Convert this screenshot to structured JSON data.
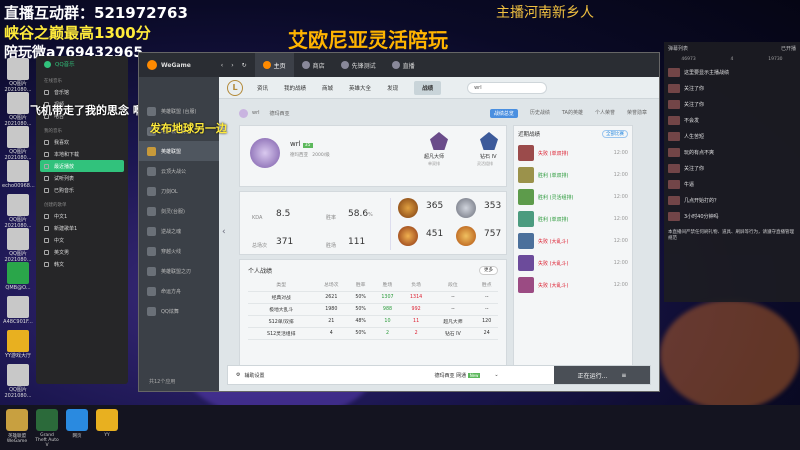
{
  "overlay": {
    "line1": "直播互动群：521972763",
    "line2": "峡谷之巅最高1300分",
    "line3": "陪玩微a769432965",
    "center_title": "艾欧尼亚灵活陪玩",
    "top_right": "主播河南新乡人",
    "tip1": "飞机带走了我的思念 啊",
    "tip2": "发布地球另一边"
  },
  "desktop": [
    "QQ图片 2021080...",
    "QQ图片 2021080...",
    "QQ图片 2021080...",
    "echo00968...",
    "QQ图片 2021080...",
    "QQ图片 2021080...",
    "QMB@O...",
    "A48C901F...",
    "YY游戏大厅",
    "QQ图片 2021080..."
  ],
  "qqmusic": {
    "title": "QQ音乐",
    "sec_online": "在线音乐",
    "online": [
      "音乐馆",
      "视频",
      "电台"
    ],
    "sec_mine": "我的音乐",
    "mine": [
      "我喜欢",
      "本地和下载",
      "最近播放",
      "试听列表",
      "已购音乐"
    ],
    "sec_created": "创建的歌单",
    "created": [
      "中文1",
      "新建歌单1",
      "中文",
      "英文男",
      "韩文"
    ]
  },
  "wegame": {
    "logo": "WeGame",
    "tabs": [
      "主页",
      "商店",
      "先锋测试",
      "直播"
    ],
    "side": [
      "英雄联盟 (台服)",
      "地下城与勇士",
      "英雄联盟",
      "云顶大战公",
      "刀剑OL",
      "剑灵(台服)",
      "逆战之魂",
      "穿越火线",
      "英雄联盟之刃",
      "命运方舟",
      "QQ炫舞"
    ],
    "side_bottom": "共12个应用",
    "bottom_left": "辅助设置",
    "bottom_server": "德玛西亚 网通",
    "bottom_tag": "New",
    "bottom_btn": "正在运行..."
  },
  "lol": {
    "nav": [
      "资讯",
      "我的战绩",
      "商城",
      "英雄大全",
      "发现",
      "战绩"
    ],
    "search": "wrl",
    "subtabs": [
      "战绩总览",
      "历史战绩",
      "TA的英雄",
      "个人荣誉",
      "荣誉勋章"
    ],
    "profile": {
      "name": "wrl",
      "badge": "35",
      "server": "德玛西亚",
      "level": "2000/级",
      "rank1": "超凡大师",
      "rank1sub": "单双排",
      "rank2": "钻石 IV",
      "rank2sub": "灵活组排"
    },
    "stats": [
      {
        "k": "KDA",
        "v": "8.5"
      },
      {
        "k": "胜率",
        "v": "58.6",
        "u": "%"
      },
      {
        "k": "总场次",
        "v": "371"
      },
      {
        "k": "胜场",
        "v": "111"
      }
    ],
    "badges": [
      "365",
      "353",
      "451",
      "757"
    ],
    "table_title": "个人战绩",
    "more": "更多",
    "headers": [
      "类型",
      "总场次",
      "胜率",
      "胜场",
      "负场",
      "段位",
      "胜点"
    ],
    "rows": [
      [
        "经典对战",
        "2621",
        "50%",
        "1307",
        "1314",
        "--",
        "--"
      ],
      [
        "极地大乱斗",
        "1980",
        "50%",
        "988",
        "992",
        "--",
        "--"
      ],
      [
        "S12单/双排",
        "21",
        "48%",
        "10",
        "11",
        "超凡大师",
        "120"
      ],
      [
        "S12灵活组排",
        "4",
        "50%",
        "2",
        "2",
        "钻石 IV",
        "24"
      ]
    ],
    "history_title": "近期战绩",
    "history_filter": "全部比赛",
    "history": [
      [
        "失败 (单双排)",
        "12:00"
      ],
      [
        "胜利 (单双排)",
        "12:00"
      ],
      [
        "胜利 (灵活组排)",
        "12:00"
      ],
      [
        "胜利 (单双排)",
        "12:00"
      ],
      [
        "失败 (大乱斗)",
        "12:00"
      ],
      [
        "失败 (大乱斗)",
        "12:00"
      ],
      [
        "失败 (大乱斗)",
        "12:00"
      ]
    ]
  },
  "chat": {
    "header": "弹幕列表",
    "btn": "已开播",
    "stats": [
      "46973",
      "4",
      "19730"
    ],
    "msgs": [
      "这里要显示主播战绩",
      "关注了你",
      "关注了你",
      "不会发",
      "人生苦短",
      "玩的有点不爽",
      "关注了你",
      "牛逼",
      "几点开始打的？",
      "3小时40分钟吗"
    ],
    "notice": "本直播间严禁任何刷礼物、道具、刷屏等行为，请遵守直播管理规范"
  },
  "taskbar": [
    "英雄联盟WeGame",
    "Grand Theft Auto V",
    "网页",
    "YY"
  ]
}
